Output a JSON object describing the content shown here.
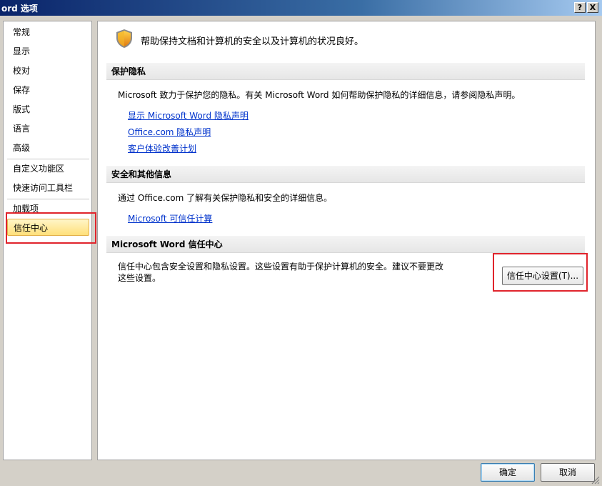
{
  "window": {
    "title": "ord 选项",
    "help_glyph": "?",
    "close_glyph": "X"
  },
  "sidebar": {
    "items": [
      {
        "label": "常规"
      },
      {
        "label": "显示"
      },
      {
        "label": "校对"
      },
      {
        "label": "保存"
      },
      {
        "label": "版式"
      },
      {
        "label": "语言"
      },
      {
        "label": "高级"
      },
      {
        "label": "自定义功能区"
      },
      {
        "label": "快速访问工具栏"
      },
      {
        "label": "加载项"
      },
      {
        "label": "信任中心",
        "selected": true
      }
    ]
  },
  "main": {
    "banner_text": "帮助保持文档和计算机的安全以及计算机的状况良好。",
    "banner_icon": "shield-icon",
    "privacy": {
      "heading": "保护隐私",
      "text": "Microsoft 致力于保护您的隐私。有关 Microsoft Word 如何帮助保护隐私的详细信息，请参阅隐私声明。",
      "links": [
        "显示 Microsoft Word 隐私声明",
        "Office.com 隐私声明",
        "客户体验改善计划"
      ]
    },
    "security": {
      "heading": "安全和其他信息",
      "text": "通过 Office.com 了解有关保护隐私和安全的详细信息。",
      "link": "Microsoft 可信任计算"
    },
    "trust_center": {
      "heading": "Microsoft Word 信任中心",
      "text_line1": "信任中心包含安全设置和隐私设置。这些设置有助于保护计算机的安全。建议不要更改",
      "text_line2": "这些设置。",
      "button_label": "信任中心设置(T)..."
    }
  },
  "footer": {
    "ok_label": "确定",
    "cancel_label": "取消"
  },
  "colors": {
    "highlight_box": "#e0242c",
    "link": "#0033cc",
    "selected_item": "#ffe07a"
  }
}
